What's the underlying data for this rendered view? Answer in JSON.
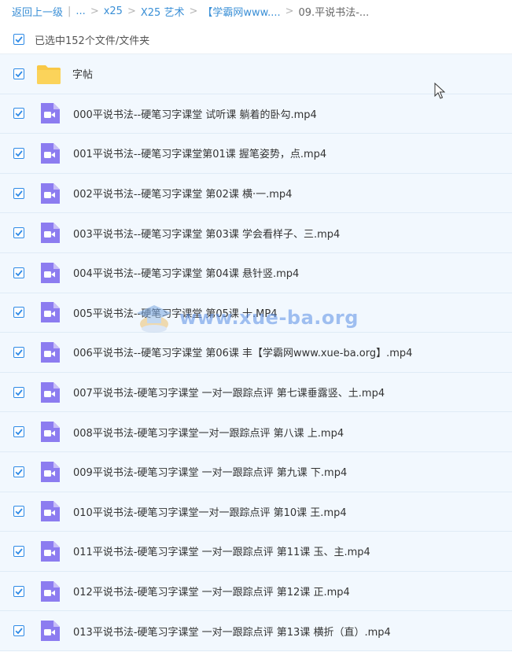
{
  "breadcrumb": {
    "back": "返回上一级",
    "ellipsis": "...",
    "items": [
      "x25",
      "X25 艺术",
      "【学霸网www....",
      "09.平说书法-..."
    ]
  },
  "selection": {
    "text": "已选中152个文件/文件夹",
    "checked": true
  },
  "files": [
    {
      "name": "字帖",
      "type": "folder-icon"
    },
    {
      "name": "000平说书法--硬笔习字课堂 试听课 躺着的卧勾.mp4",
      "type": "video-file-icon"
    },
    {
      "name": "001平说书法--硬笔习字课堂第01课 握笔姿势，点.mp4",
      "type": "video-file-icon"
    },
    {
      "name": "002平说书法--硬笔习字课堂 第02课 横·一.mp4",
      "type": "video-file-icon"
    },
    {
      "name": "003平说书法--硬笔习字课堂 第03课 学会看样子、三.mp4",
      "type": "video-file-icon"
    },
    {
      "name": "004平说书法--硬笔习字课堂 第04课 悬针竖.mp4",
      "type": "video-file-icon"
    },
    {
      "name": "005平说书法--硬笔习字课堂 第05课 十.MP4",
      "type": "video-file-icon"
    },
    {
      "name": "006平说书法--硬笔习字课堂 第06课 丰【学霸网www.xue-ba.org】.mp4",
      "type": "video-file-icon"
    },
    {
      "name": "007平说书法-硬笔习字课堂 一对一跟踪点评 第七课垂露竖、土.mp4",
      "type": "video-file-icon"
    },
    {
      "name": "008平说书法-硬笔习字课堂一对一跟踪点评 第八课 上.mp4",
      "type": "video-file-icon"
    },
    {
      "name": "009平说书法-硬笔习字课堂 一对一跟踪点评 第九课 下.mp4",
      "type": "video-file-icon"
    },
    {
      "name": "010平说书法-硬笔习字课堂一对一跟踪点评 第10课 王.mp4",
      "type": "video-file-icon"
    },
    {
      "name": "011平说书法-硬笔习字课堂 一对一跟踪点评 第11课 玉、主.mp4",
      "type": "video-file-icon"
    },
    {
      "name": "012平说书法-硬笔习字课堂 一对一跟踪点评 第12课 正.mp4",
      "type": "video-file-icon"
    },
    {
      "name": "013平说书法-硬笔习字课堂 一对一跟踪点评 第13课 横折（直）.mp4",
      "type": "video-file-icon"
    }
  ],
  "watermark": {
    "text": "www.xue-ba.org"
  },
  "colors": {
    "accent": "#2e8ae6",
    "row_bg": "#f2f8fe",
    "video_icon": "#8c7cf0",
    "folder": "#f9c846"
  }
}
